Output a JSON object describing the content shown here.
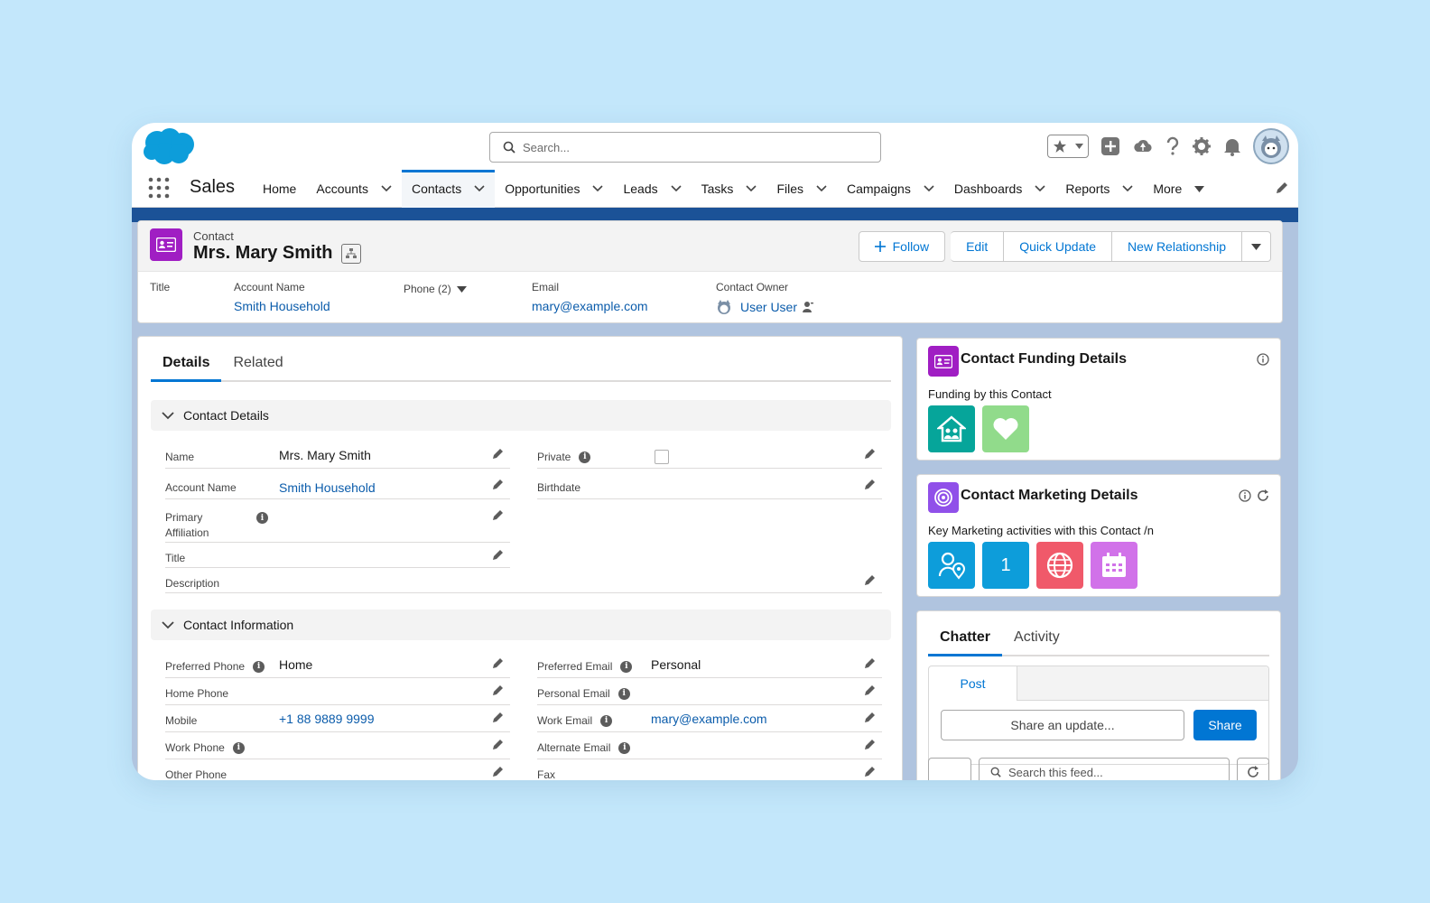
{
  "search": {
    "placeholder": "Search..."
  },
  "nav": {
    "app_name": "Sales",
    "items": [
      {
        "label": "Home"
      },
      {
        "label": "Accounts"
      },
      {
        "label": "Contacts"
      },
      {
        "label": "Opportunities"
      },
      {
        "label": "Leads"
      },
      {
        "label": "Tasks"
      },
      {
        "label": "Files"
      },
      {
        "label": "Campaigns"
      },
      {
        "label": "Dashboards"
      },
      {
        "label": "Reports"
      },
      {
        "label": "More"
      }
    ]
  },
  "record": {
    "type_label": "Contact",
    "name": "Mrs. Mary Smith",
    "actions": {
      "follow": "Follow",
      "edit": "Edit",
      "quick_update": "Quick Update",
      "new_relationship": "New Relationship"
    },
    "highlights": {
      "title_label": "Title",
      "account_label": "Account Name",
      "account_value": "Smith Household",
      "phone_label": "Phone (2)",
      "email_label": "Email",
      "email_value": "mary@example.com",
      "owner_label": "Contact Owner",
      "owner_value": "User User"
    }
  },
  "tabs": {
    "details": "Details",
    "related": "Related"
  },
  "contact_details": {
    "header": "Contact Details",
    "name_label": "Name",
    "name_value": "Mrs. Mary Smith",
    "account_label": "Account Name",
    "account_value": "Smith Household",
    "primary_affiliation_label_1": "Primary",
    "primary_affiliation_label_2": "Affiliation",
    "title_label": "Title",
    "description_label": "Description",
    "private_label": "Private",
    "birthdate_label": "Birthdate"
  },
  "contact_info": {
    "header": "Contact Information",
    "preferred_phone_label": "Preferred Phone",
    "preferred_phone_value": "Home",
    "home_phone_label": "Home Phone",
    "mobile_label": "Mobile",
    "mobile_value": "+1 88 9889 9999",
    "work_phone_label": "Work Phone",
    "other_phone_label": "Other Phone",
    "preferred_email_label": "Preferred Email",
    "preferred_email_value": "Personal",
    "personal_email_label": "Personal Email",
    "work_email_label": "Work Email",
    "work_email_value": "mary@example.com",
    "alternate_email_label": "Alternate Email",
    "fax_label": "Fax"
  },
  "funding_card": {
    "title": "Contact Funding Details",
    "subtitle": "Funding by this Contact"
  },
  "marketing_card": {
    "title": "Contact Marketing Details",
    "subtitle": "Key Marketing activities with this Contact /n",
    "tile_count": "1"
  },
  "chatter": {
    "tab_chatter": "Chatter",
    "tab_activity": "Activity",
    "post_tab": "Post",
    "share_placeholder": "Share an update...",
    "share_button": "Share",
    "feed_search_placeholder": "Search this feed..."
  },
  "colors": {
    "brand_blue": "#0176d3",
    "link": "#0b5cab",
    "contact_purple": "#a01ec3",
    "teal": "#06a59a",
    "mint": "#91db8b",
    "marketing_purple": "#9050e9",
    "coral": "#f0596a",
    "lavender": "#d172e9"
  }
}
